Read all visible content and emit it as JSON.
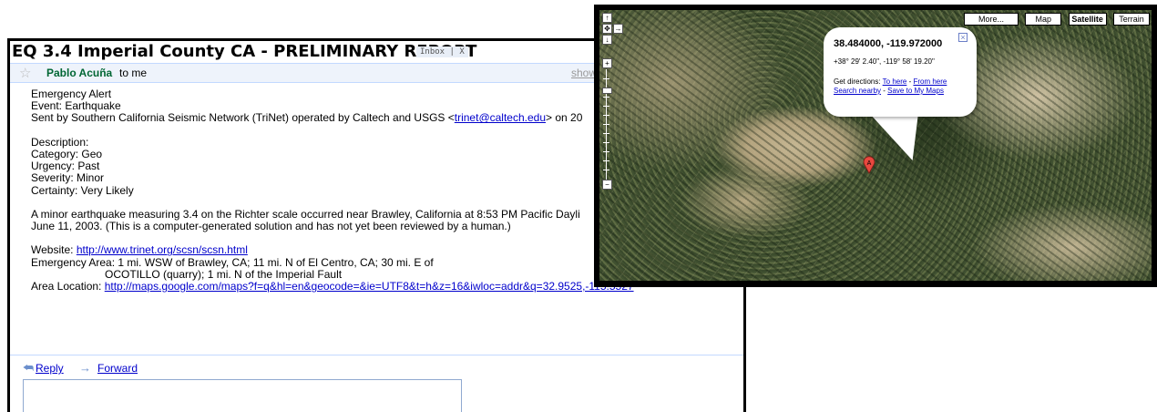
{
  "email": {
    "subject": "EQ 3.4 Imperial County CA - PRELIMINARY REPORT",
    "label_chip": "Inbox | X",
    "sender": "Pablo Acuña",
    "recipient": "to me",
    "show_details": "show",
    "body": {
      "l1": "Emergency Alert",
      "l2": "Event: Earthquake",
      "l3_prefix": "Sent by Southern California Seismic Network (TriNet) operated by Caltech and USGS <",
      "l3_link": "trinet@caltech.edu",
      "l3_suffix": "> on 20",
      "l4": "Description:",
      "l5": "Category: Geo",
      "l6": "Urgency: Past",
      "l7": "Severity: Minor",
      "l8": "Certainty: Very Likely",
      "l9": "A minor earthquake measuring 3.4 on the Richter scale occurred near Brawley, California at 8:53 PM Pacific Dayli",
      "l10": "June 11, 2003. (This is a computer-generated solution and has not yet been reviewed by a human.)",
      "website_label": "Website: ",
      "website_link": "http://www.trinet.org/scsn/scsn.html",
      "area1": "Emergency Area: 1 mi. WSW of Brawley, CA; 11 mi. N of El Centro, CA; 30 mi. E of",
      "area2": "OCOTILLO (quarry); 1 mi. N of the Imperial Fault",
      "location_label": "Area Location: ",
      "location_link": "http://maps.google.com/maps?f=q&hl=en&geocode=&ie=UTF8&t=h&z=16&iwloc=addr&q=32.9525,-115.5527"
    },
    "actions": {
      "reply": "Reply",
      "forward": "Forward"
    }
  },
  "map": {
    "types": {
      "more": "More...",
      "map": "Map",
      "satellite": "Satellite",
      "terrain": "Terrain"
    },
    "selected_type": "Satellite",
    "controls": {
      "up": "↑",
      "left": "←",
      "right": "→",
      "center": "✥",
      "down": "↓",
      "zoom_in": "+",
      "zoom_out": "−"
    },
    "zoom_level_fraction": 0.17,
    "info_window": {
      "coords": "38.484000, -119.972000",
      "dms": "+38° 29' 2.40\", -119° 58' 19.20\"",
      "directions_label": "Get directions: ",
      "to_here": "To here",
      "separator": " - ",
      "from_here": "From here",
      "search_nearby": "Search nearby",
      "save_to_maps": "Save to My Maps",
      "close": "×"
    },
    "marker_label": "A",
    "colors": {
      "marker": "#e8483f",
      "link": "#0000cc"
    }
  }
}
